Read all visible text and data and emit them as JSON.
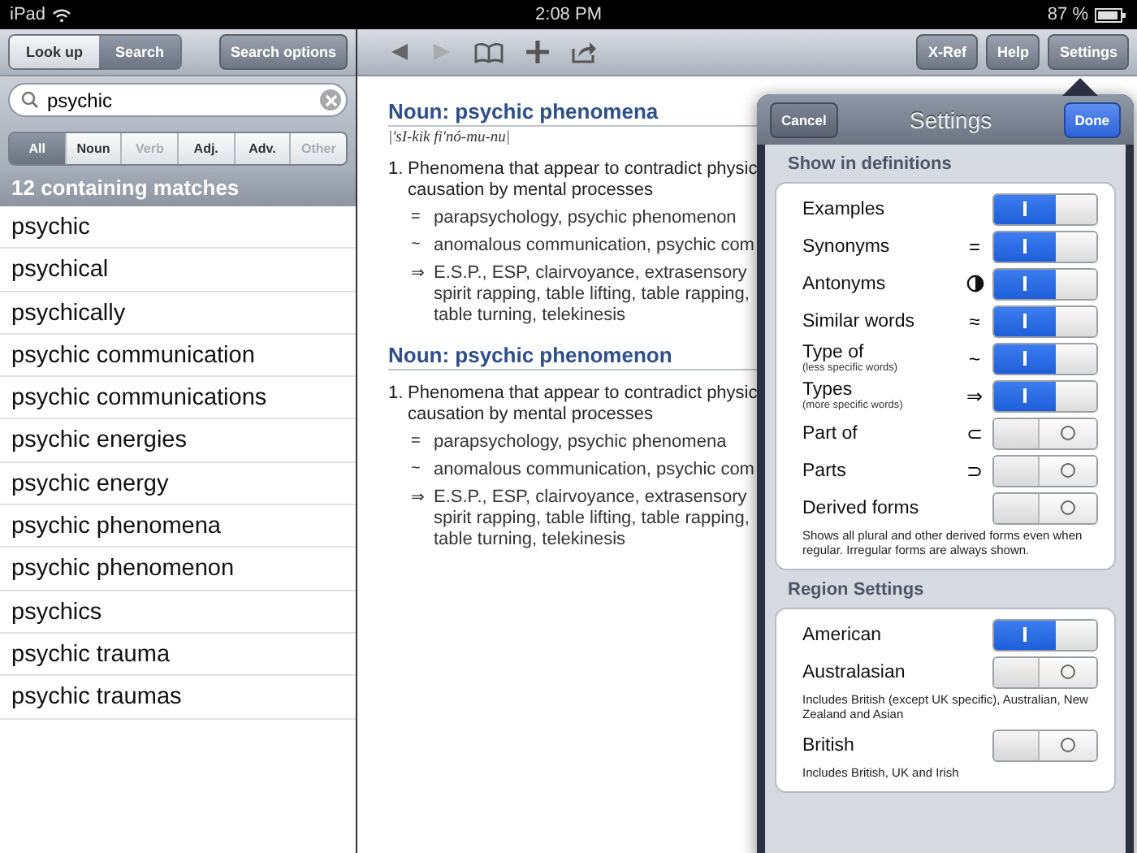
{
  "status_bar": {
    "device": "iPad",
    "time": "2:08 PM",
    "battery": "87 %"
  },
  "sidebar": {
    "modes": [
      {
        "label": "Look up",
        "selected": false
      },
      {
        "label": "Search",
        "selected": true
      }
    ],
    "options_button": "Search options",
    "search": {
      "value": "psychic"
    },
    "filters": [
      {
        "label": "All",
        "selected": true,
        "disabled": false
      },
      {
        "label": "Noun",
        "selected": false,
        "disabled": false
      },
      {
        "label": "Verb",
        "selected": false,
        "disabled": true
      },
      {
        "label": "Adj.",
        "selected": false,
        "disabled": false
      },
      {
        "label": "Adv.",
        "selected": false,
        "disabled": false
      },
      {
        "label": "Other",
        "selected": false,
        "disabled": true
      }
    ],
    "results_header": "12 containing matches",
    "results": [
      "psychic",
      "psychical",
      "psychically",
      "psychic communication",
      "psychic communications",
      "psychic energies",
      "psychic energy",
      "psychic phenomena",
      "psychic phenomenon",
      "psychics",
      "psychic trauma",
      "psychic traumas"
    ]
  },
  "toolbar": {
    "buttons": [
      "X-Ref",
      "Help",
      "Settings"
    ]
  },
  "entries": [
    {
      "heading": "Noun: psychic phenomena",
      "pronunciation": "|'sI-kik fi'nó-mu-nu|",
      "number": "1.",
      "lines": [
        "Phenomena that appear to contradict physic",
        "causation by mental processes"
      ],
      "relations": [
        {
          "symbol": "=",
          "lines": [
            "parapsychology, psychic phenomenon"
          ]
        },
        {
          "symbol": "~",
          "lines": [
            "anomalous communication, psychic com"
          ]
        },
        {
          "symbol": "⇒",
          "lines": [
            "E.S.P., ESP, clairvoyance, extrasensory",
            "spirit rapping, table lifting, table rapping,",
            "table turning, telekinesis"
          ]
        }
      ]
    },
    {
      "heading": "Noun: psychic phenomenon",
      "number": "1.",
      "lines": [
        "Phenomena that appear to contradict physic",
        "causation by mental processes"
      ],
      "relations": [
        {
          "symbol": "=",
          "lines": [
            "parapsychology, psychic phenomena"
          ]
        },
        {
          "symbol": "~",
          "lines": [
            "anomalous communication, psychic com"
          ]
        },
        {
          "symbol": "⇒",
          "lines": [
            "E.S.P., ESP, clairvoyance, extrasensory",
            "spirit rapping, table lifting, table rapping,",
            "table turning, telekinesis"
          ]
        }
      ]
    }
  ],
  "settings": {
    "cancel": "Cancel",
    "title": "Settings",
    "done": "Done",
    "sections": [
      {
        "title": "Show in definitions",
        "items": [
          {
            "label": "Examples",
            "kind": "plain",
            "on": true
          },
          {
            "label": "Synonyms",
            "kind": "symbol",
            "symbol": "=",
            "on": true
          },
          {
            "label": "Antonyms",
            "kind": "half-circle",
            "on": true
          },
          {
            "label": "Similar words",
            "kind": "symbol",
            "symbol": "≈",
            "on": true
          },
          {
            "label": "Type of",
            "note": "(less specific words)",
            "kind": "symbol",
            "symbol": "~",
            "on": true
          },
          {
            "label": "Types",
            "note": "(more specific words)",
            "kind": "symbol",
            "symbol": "⇒",
            "on": true
          },
          {
            "label": "Part of",
            "kind": "symbol",
            "symbol": "⊂",
            "on": false
          },
          {
            "label": "Parts",
            "kind": "symbol",
            "symbol": "⊃",
            "on": false
          },
          {
            "label": "Derived forms",
            "kind": "plain",
            "on": false,
            "hint": "Shows all plural and other derived forms even when regular. Irregular forms are always shown."
          }
        ]
      },
      {
        "title": "Region Settings",
        "items": [
          {
            "label": "American",
            "kind": "plain",
            "on": true
          },
          {
            "label": "Australasian",
            "kind": "plain",
            "on": false,
            "hint": "Includes British (except UK specific), Australian, New Zealand and Asian"
          },
          {
            "label": "British",
            "kind": "plain",
            "on": false,
            "hint": "Includes British, UK and Irish"
          }
        ]
      }
    ]
  }
}
